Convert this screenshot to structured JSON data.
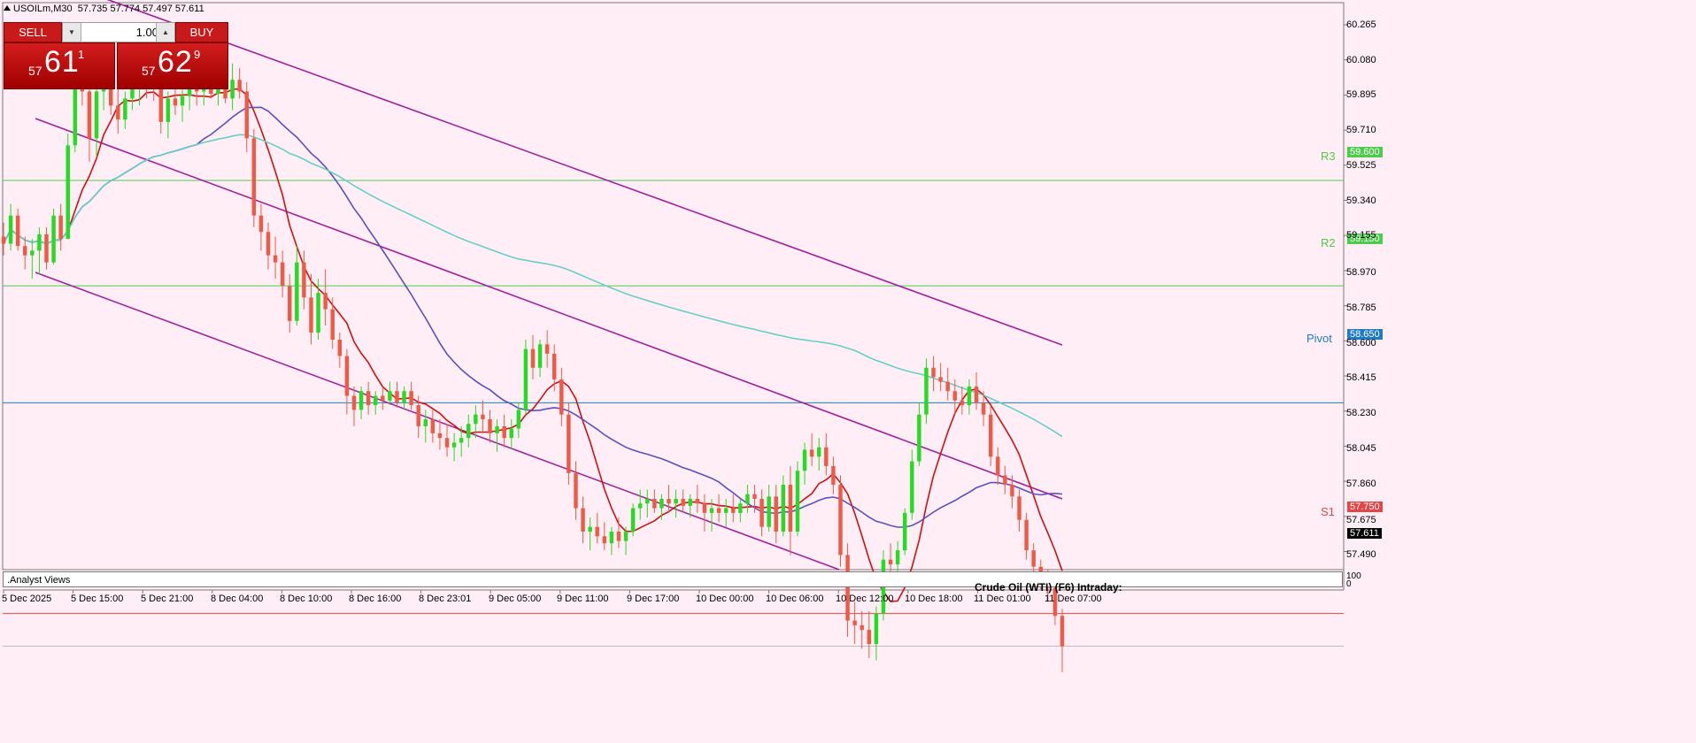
{
  "header": {
    "symbol": "USOILm,M30",
    "ohlc": "57.735 57.774 57.497 57.611"
  },
  "trade_panel": {
    "sell_label": "SELL",
    "buy_label": "BUY",
    "lot_value": "1.00",
    "sell_price": {
      "prefix": "57",
      "big": "61",
      "sup": "1"
    },
    "buy_price": {
      "prefix": "57",
      "big": "62",
      "sup": "9"
    }
  },
  "price_axis": [
    "60.265",
    "60.080",
    "59.895",
    "59.710",
    "59.525",
    "59.340",
    "59.155",
    "58.970",
    "58.785",
    "58.600",
    "58.415",
    "58.230",
    "58.045",
    "57.860",
    "57.675",
    "57.490"
  ],
  "time_axis": [
    "5 Dec 2025",
    "5 Dec 15:00",
    "5 Dec 21:00",
    "8 Dec 04:00",
    "8 Dec 10:00",
    "8 Dec 16:00",
    "8 Dec 23:01",
    "9 Dec 05:00",
    "9 Dec 11:00",
    "9 Dec 17:00",
    "10 Dec 00:00",
    "10 Dec 06:00",
    "10 Dec 12:00",
    "10 Dec 18:00",
    "11 Dec 01:00",
    "11 Dec 07:00"
  ],
  "levels": [
    {
      "name": "R3",
      "price": 59.6,
      "label": "59.600",
      "color": "#4ccc4c"
    },
    {
      "name": "R2",
      "price": 59.15,
      "label": "59.150",
      "color": "#4ccc4c"
    },
    {
      "name": "Pivot",
      "price": 58.65,
      "label": "58.650",
      "color": "#1e7bc4"
    },
    {
      "name": "S1",
      "price": 57.75,
      "label": "57.750",
      "color": "#e34646"
    }
  ],
  "current_price": {
    "label": "57.611",
    "price": 57.611
  },
  "subwindow": {
    "name": ".Analyst Views",
    "axis_top": "100",
    "axis_bottom": "0",
    "title": "Crude Oil (WTI) (F6) Intraday:"
  },
  "colors": {
    "background": "#ffeef5",
    "bull": "#22dd22",
    "bear": "#ef5a46",
    "ma_fast": "#d01010",
    "ma_mid": "#5b4fbf",
    "ma_slow": "#66cfc8",
    "channel": "#a020a0"
  },
  "chart_data": {
    "type": "candlestick",
    "timeframe": "M30",
    "ylim": [
      57.45,
      60.35
    ],
    "candles": [
      [
        59.36,
        59.42,
        59.28,
        59.33
      ],
      [
        59.33,
        59.5,
        59.3,
        59.45
      ],
      [
        59.45,
        59.48,
        59.3,
        59.32
      ],
      [
        59.32,
        59.36,
        59.22,
        59.28
      ],
      [
        59.28,
        59.35,
        59.18,
        59.3
      ],
      [
        59.3,
        59.4,
        59.2,
        59.37
      ],
      [
        59.37,
        59.4,
        59.22,
        59.25
      ],
      [
        59.25,
        59.48,
        59.24,
        59.45
      ],
      [
        59.45,
        59.5,
        59.3,
        59.35
      ],
      [
        59.35,
        59.8,
        59.35,
        59.75
      ],
      [
        59.75,
        60.12,
        59.72,
        60.02
      ],
      [
        60.02,
        60.2,
        59.92,
        59.98
      ],
      [
        59.98,
        60.05,
        59.68,
        59.78
      ],
      [
        59.78,
        60.1,
        59.7,
        59.98
      ],
      [
        59.98,
        60.1,
        59.9,
        60.05
      ],
      [
        60.05,
        60.1,
        59.88,
        59.92
      ],
      [
        59.92,
        60.0,
        59.8,
        59.86
      ],
      [
        59.86,
        59.98,
        59.82,
        59.95
      ],
      [
        59.95,
        60.05,
        59.9,
        59.99
      ],
      [
        59.99,
        60.06,
        59.92,
        60.03
      ],
      [
        60.03,
        60.08,
        59.95,
        60.02
      ],
      [
        60.02,
        60.1,
        59.94,
        60.0
      ],
      [
        60.0,
        60.05,
        59.8,
        59.85
      ],
      [
        59.85,
        59.98,
        59.78,
        59.95
      ],
      [
        59.95,
        60.02,
        59.88,
        59.92
      ],
      [
        59.92,
        60.0,
        59.85,
        59.96
      ],
      [
        59.96,
        60.04,
        59.9,
        60.0
      ],
      [
        60.0,
        60.06,
        59.92,
        59.98
      ],
      [
        59.98,
        60.05,
        59.92,
        60.02
      ],
      [
        60.02,
        60.08,
        59.95,
        59.97
      ],
      [
        59.97,
        60.04,
        59.92,
        60.0
      ],
      [
        60.0,
        60.06,
        59.93,
        59.95
      ],
      [
        59.95,
        60.1,
        59.9,
        60.03
      ],
      [
        60.03,
        60.08,
        59.95,
        59.98
      ],
      [
        59.98,
        60.02,
        59.72,
        59.78
      ],
      [
        59.78,
        59.82,
        59.4,
        59.45
      ],
      [
        59.45,
        59.5,
        59.3,
        59.38
      ],
      [
        59.38,
        59.42,
        59.22,
        59.28
      ],
      [
        59.28,
        59.36,
        59.18,
        59.25
      ],
      [
        59.25,
        59.3,
        59.1,
        59.15
      ],
      [
        59.15,
        59.2,
        58.95,
        59.0
      ],
      [
        59.0,
        59.32,
        58.98,
        59.25
      ],
      [
        59.25,
        59.3,
        59.05,
        59.1
      ],
      [
        59.1,
        59.2,
        58.9,
        58.95
      ],
      [
        58.95,
        59.18,
        58.92,
        59.12
      ],
      [
        59.12,
        59.22,
        58.98,
        59.05
      ],
      [
        59.05,
        59.1,
        58.88,
        58.92
      ],
      [
        58.92,
        58.95,
        58.8,
        58.85
      ],
      [
        58.85,
        58.88,
        58.6,
        58.68
      ],
      [
        58.68,
        58.72,
        58.55,
        58.62
      ],
      [
        58.62,
        58.72,
        58.58,
        58.7
      ],
      [
        58.7,
        58.74,
        58.6,
        58.64
      ],
      [
        58.64,
        58.7,
        58.6,
        58.68
      ],
      [
        58.68,
        58.72,
        58.62,
        58.66
      ],
      [
        58.66,
        58.74,
        58.64,
        58.7
      ],
      [
        58.7,
        58.74,
        58.63,
        58.65
      ],
      [
        58.65,
        58.72,
        58.62,
        58.7
      ],
      [
        58.7,
        58.74,
        58.62,
        58.64
      ],
      [
        58.64,
        58.68,
        58.5,
        58.55
      ],
      [
        58.55,
        58.62,
        58.48,
        58.58
      ],
      [
        58.58,
        58.62,
        58.48,
        58.52
      ],
      [
        58.52,
        58.58,
        58.45,
        58.5
      ],
      [
        58.5,
        58.56,
        58.42,
        58.46
      ],
      [
        58.46,
        58.52,
        58.4,
        58.48
      ],
      [
        58.48,
        58.55,
        58.42,
        58.5
      ],
      [
        58.5,
        58.6,
        58.46,
        58.56
      ],
      [
        58.56,
        58.64,
        58.5,
        58.6
      ],
      [
        58.6,
        58.66,
        58.52,
        58.58
      ],
      [
        58.58,
        58.62,
        58.48,
        58.52
      ],
      [
        58.52,
        58.58,
        58.44,
        58.55
      ],
      [
        58.55,
        58.6,
        58.46,
        58.5
      ],
      [
        58.5,
        58.58,
        58.45,
        58.54
      ],
      [
        58.54,
        58.65,
        58.5,
        58.62
      ],
      [
        58.62,
        58.92,
        58.6,
        58.88
      ],
      [
        58.88,
        58.94,
        58.75,
        58.8
      ],
      [
        58.8,
        58.92,
        58.76,
        58.9
      ],
      [
        58.9,
        58.96,
        58.8,
        58.86
      ],
      [
        58.86,
        58.9,
        58.7,
        58.75
      ],
      [
        58.75,
        58.8,
        58.55,
        58.6
      ],
      [
        58.6,
        58.65,
        58.3,
        58.35
      ],
      [
        58.35,
        58.4,
        58.15,
        58.2
      ],
      [
        58.2,
        58.25,
        58.05,
        58.1
      ],
      [
        58.1,
        58.16,
        58.02,
        58.12
      ],
      [
        58.12,
        58.18,
        58.05,
        58.08
      ],
      [
        58.08,
        58.14,
        58.02,
        58.05
      ],
      [
        58.05,
        58.12,
        58.0,
        58.1
      ],
      [
        58.1,
        58.16,
        58.03,
        58.06
      ],
      [
        58.06,
        58.12,
        58.0,
        58.1
      ],
      [
        58.1,
        58.22,
        58.08,
        58.2
      ],
      [
        58.2,
        58.28,
        58.15,
        58.22
      ],
      [
        58.22,
        58.28,
        58.16,
        58.24
      ],
      [
        58.24,
        58.28,
        58.18,
        58.2
      ],
      [
        58.2,
        58.26,
        58.15,
        58.24
      ],
      [
        58.24,
        58.3,
        58.18,
        58.22
      ],
      [
        58.22,
        58.28,
        58.16,
        58.24
      ],
      [
        58.24,
        58.28,
        58.18,
        58.21
      ],
      [
        58.21,
        58.26,
        58.16,
        58.24
      ],
      [
        58.24,
        58.3,
        58.18,
        58.22
      ],
      [
        58.22,
        58.26,
        58.1,
        58.18
      ],
      [
        58.18,
        58.24,
        58.1,
        58.2
      ],
      [
        58.2,
        58.26,
        58.14,
        58.18
      ],
      [
        58.18,
        58.24,
        58.12,
        58.2
      ],
      [
        58.2,
        58.26,
        58.14,
        58.18
      ],
      [
        58.18,
        58.24,
        58.14,
        58.22
      ],
      [
        58.22,
        58.3,
        58.18,
        58.26
      ],
      [
        58.26,
        58.3,
        58.18,
        58.24
      ],
      [
        58.24,
        58.28,
        58.08,
        58.12
      ],
      [
        58.12,
        58.3,
        58.1,
        58.25
      ],
      [
        58.25,
        58.3,
        58.05,
        58.1
      ],
      [
        58.1,
        58.34,
        58.08,
        58.3
      ],
      [
        58.3,
        58.38,
        58.0,
        58.1
      ],
      [
        58.1,
        58.4,
        58.08,
        58.36
      ],
      [
        58.36,
        58.48,
        58.3,
        58.45
      ],
      [
        58.45,
        58.52,
        58.38,
        58.42
      ],
      [
        58.42,
        58.5,
        58.36,
        58.46
      ],
      [
        58.46,
        58.52,
        58.34,
        58.38
      ],
      [
        58.38,
        58.42,
        58.26,
        58.3
      ],
      [
        58.3,
        58.34,
        57.95,
        58.0
      ],
      [
        58.0,
        58.05,
        57.65,
        57.72
      ],
      [
        57.72,
        57.8,
        57.62,
        57.7
      ],
      [
        57.7,
        57.76,
        57.6,
        57.68
      ],
      [
        57.68,
        57.76,
        57.56,
        57.62
      ],
      [
        57.62,
        57.78,
        57.55,
        57.75
      ],
      [
        57.75,
        58.02,
        57.72,
        57.98
      ],
      [
        57.98,
        58.05,
        57.9,
        57.96
      ],
      [
        57.96,
        58.06,
        57.92,
        58.02
      ],
      [
        58.02,
        58.2,
        58.0,
        58.18
      ],
      [
        58.18,
        58.45,
        58.15,
        58.4
      ],
      [
        58.4,
        58.65,
        58.38,
        58.6
      ],
      [
        58.6,
        58.84,
        58.56,
        58.8
      ],
      [
        58.8,
        58.85,
        58.7,
        58.76
      ],
      [
        58.76,
        58.82,
        58.7,
        58.74
      ],
      [
        58.74,
        58.8,
        58.66,
        58.7
      ],
      [
        58.7,
        58.75,
        58.6,
        58.66
      ],
      [
        58.66,
        58.72,
        58.6,
        58.64
      ],
      [
        58.64,
        58.75,
        58.6,
        58.72
      ],
      [
        58.72,
        58.78,
        58.62,
        58.65
      ],
      [
        58.65,
        58.7,
        58.55,
        58.6
      ],
      [
        58.6,
        58.64,
        58.38,
        58.42
      ],
      [
        58.42,
        58.46,
        58.3,
        58.34
      ],
      [
        58.34,
        58.38,
        58.26,
        58.3
      ],
      [
        58.3,
        58.34,
        58.2,
        58.25
      ],
      [
        58.25,
        58.28,
        58.1,
        58.15
      ],
      [
        58.15,
        58.18,
        57.98,
        58.02
      ],
      [
        58.02,
        58.05,
        57.92,
        57.95
      ],
      [
        57.95,
        57.98,
        57.85,
        57.88
      ],
      [
        57.88,
        57.94,
        57.8,
        57.86
      ],
      [
        57.86,
        57.88,
        57.7,
        57.74
      ],
      [
        57.74,
        57.77,
        57.5,
        57.61
      ]
    ],
    "indicators": [
      "moving_average_fast",
      "moving_average_mid",
      "moving_average_slow",
      "regression_channel"
    ],
    "levels": {
      "R3": 59.6,
      "R2": 59.15,
      "Pivot": 58.65,
      "S1": 57.75
    }
  }
}
